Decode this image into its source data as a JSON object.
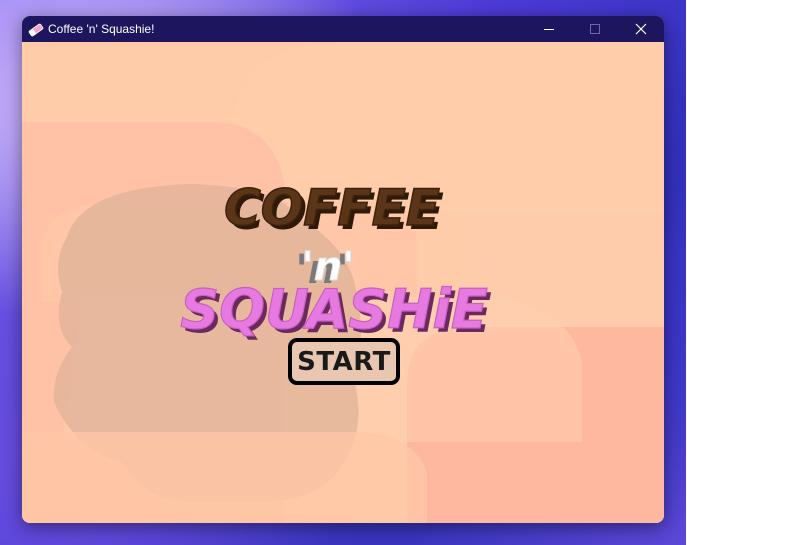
{
  "window": {
    "title": "Coffee 'n' Squashie!",
    "app_icon": "eraser-icon",
    "controls": [
      "minimize-icon",
      "maximize-icon",
      "close-icon"
    ]
  },
  "game": {
    "logo": {
      "line1": "COFFEE",
      "line2": "'n'",
      "line3": "SQUASHiE"
    },
    "start_label": "START"
  },
  "colors": {
    "titlebar": "#1e155f",
    "background": "#ffccaa",
    "coffee_text": "#5a3518",
    "n_text": "#ffffff",
    "squashie_text": "#e77ae0",
    "button_fill": "#e8c6b0",
    "button_border": "#000000"
  }
}
